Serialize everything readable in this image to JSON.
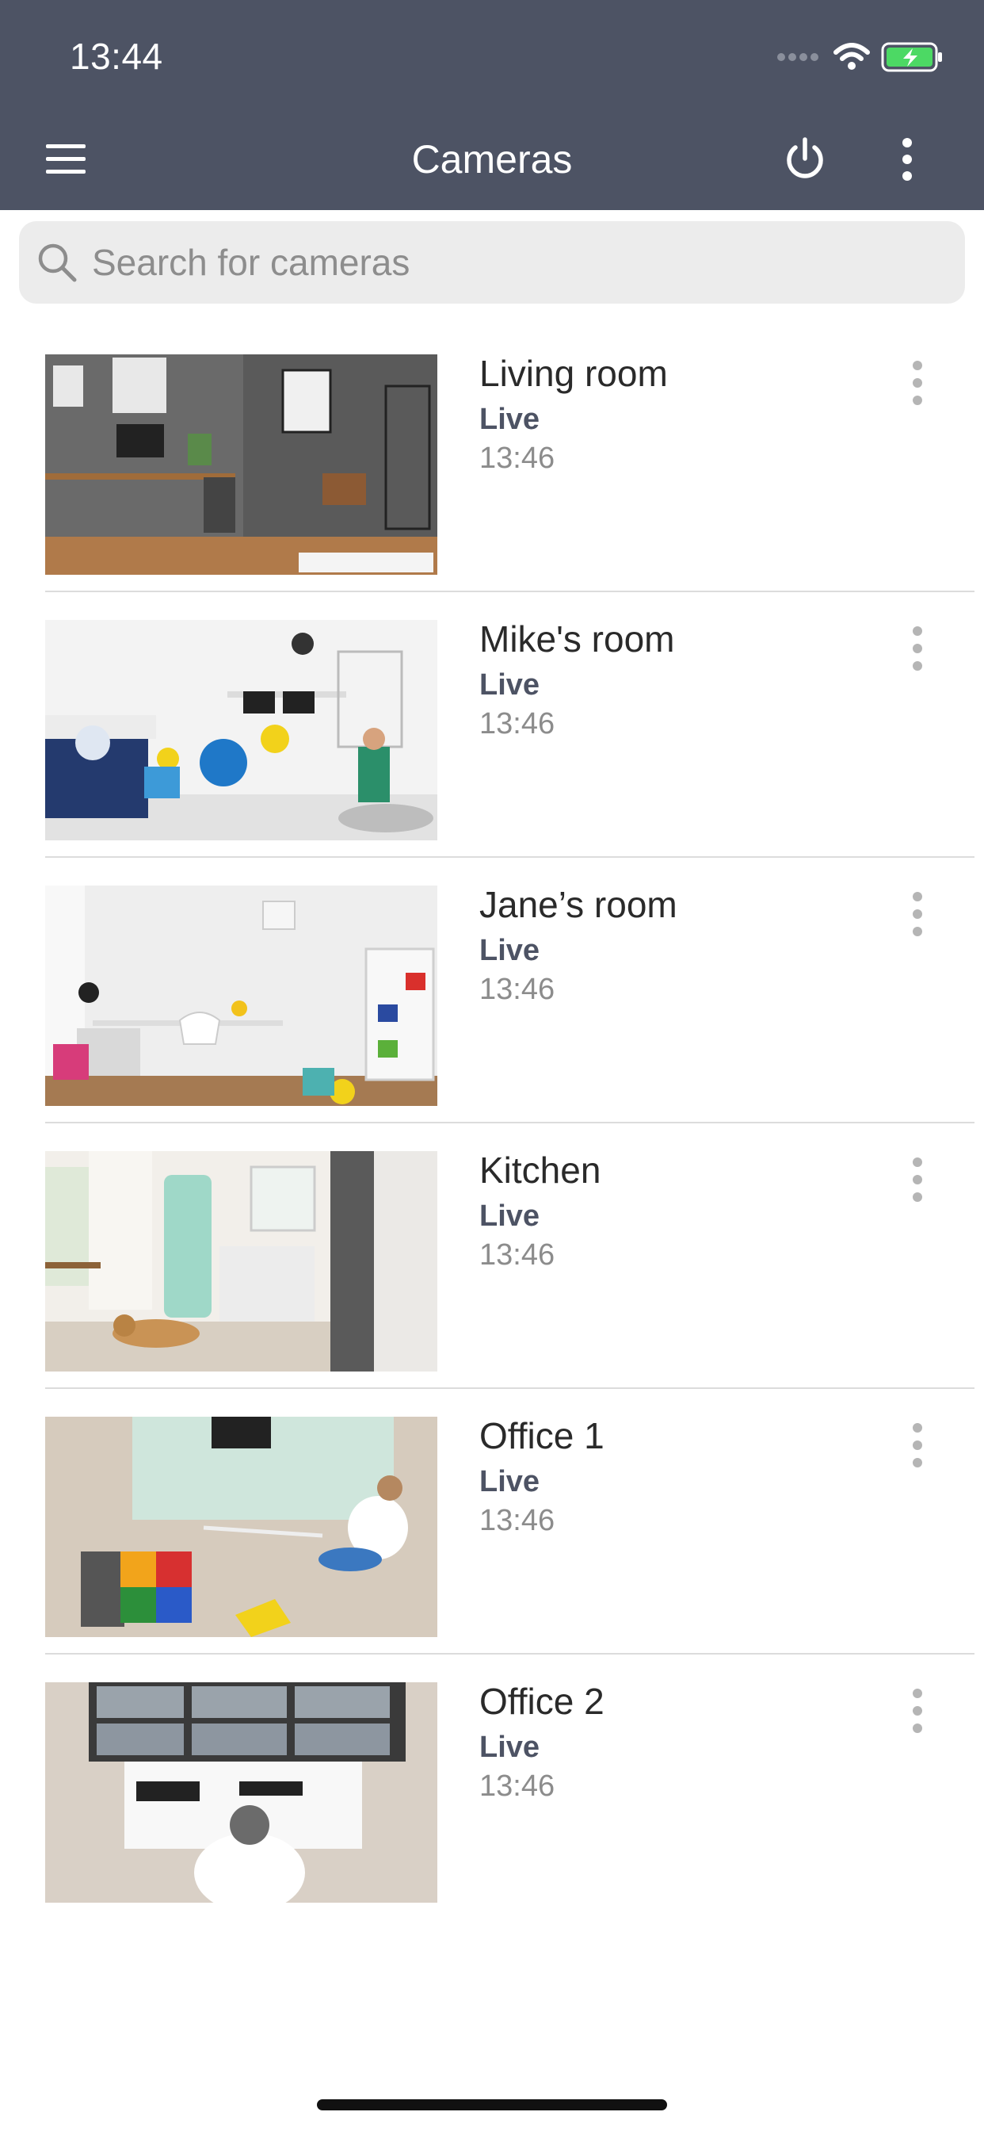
{
  "status_bar": {
    "time": "13:44"
  },
  "nav": {
    "title": "Cameras",
    "icons": [
      "menu-icon",
      "power-icon",
      "more-vertical-icon"
    ]
  },
  "search": {
    "placeholder": "Search for cameras",
    "value": ""
  },
  "cameras": [
    {
      "name": "Living room",
      "status": "Live",
      "time": "13:46",
      "thumbnail": "living-room-photo"
    },
    {
      "name": "Mike's room",
      "status": "Live",
      "time": "13:46",
      "thumbnail": "kids-room-photo"
    },
    {
      "name": "Jane’s room",
      "status": "Live",
      "time": "13:46",
      "thumbnail": "white-room-photo"
    },
    {
      "name": "Kitchen",
      "status": "Live",
      "time": "13:46",
      "thumbnail": "kitchen-photo"
    },
    {
      "name": "Office 1",
      "status": "Live",
      "time": "13:46",
      "thumbnail": "office-cleaning-photo"
    },
    {
      "name": "Office 2",
      "status": "Live",
      "time": "13:46",
      "thumbnail": "surveillance-desk-photo"
    }
  ],
  "colors": {
    "header_bg": "#4d5364",
    "live_text": "#4d5364",
    "battery_fill": "#4cd964"
  }
}
